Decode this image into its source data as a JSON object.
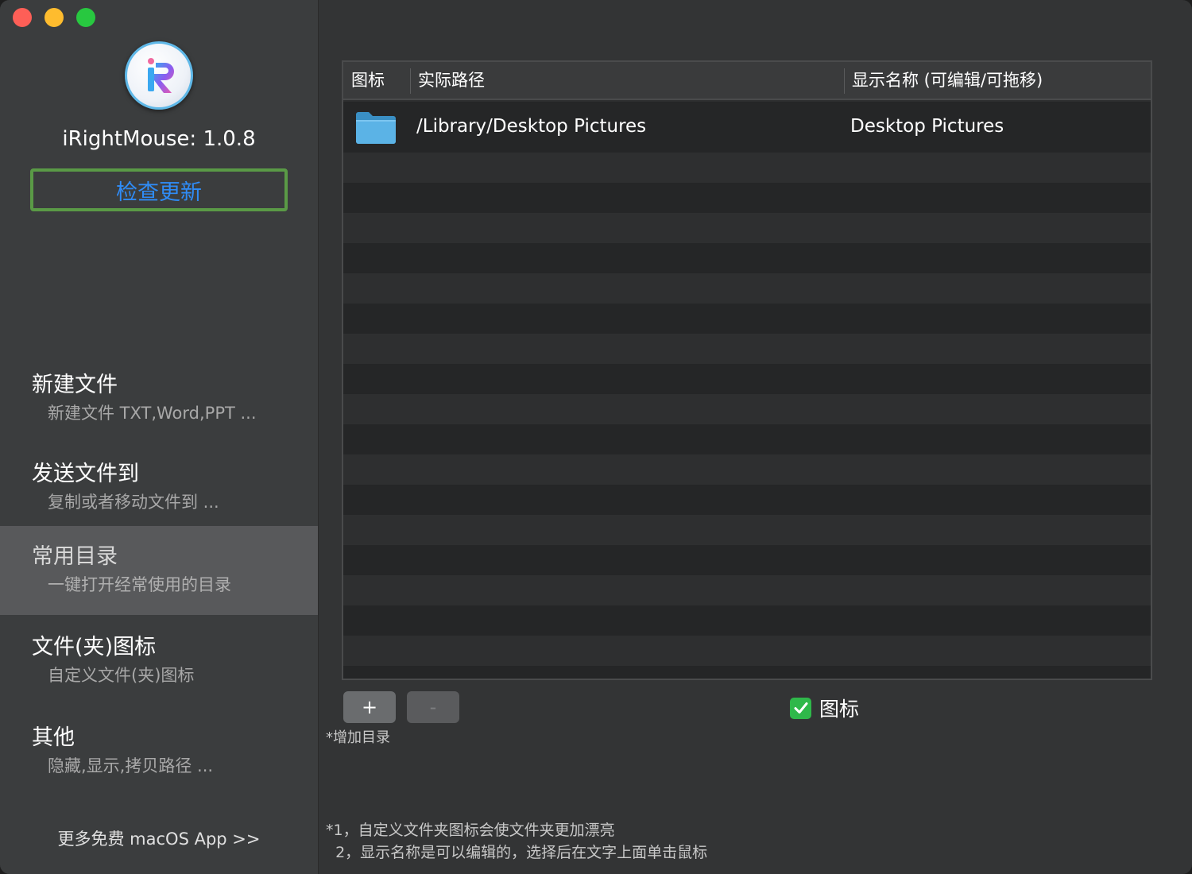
{
  "window": {
    "traffic_lights": {
      "close": "#fe5f57",
      "minimize": "#febc2e",
      "zoom": "#28c840"
    }
  },
  "sidebar": {
    "app_version": "iRightMouse: 1.0.8",
    "update_button": "检查更新",
    "items": [
      {
        "title": "新建文件",
        "subtitle": "新建文件 TXT,Word,PPT ...",
        "active": false
      },
      {
        "title": "发送文件到",
        "subtitle": "复制或者移动文件到 ...",
        "active": false
      },
      {
        "title": "常用目录",
        "subtitle": "一键打开经常使用的目录",
        "active": true
      },
      {
        "title": "文件(夹)图标",
        "subtitle": "自定义文件(夹)图标",
        "active": false
      },
      {
        "title": "其他",
        "subtitle": "隐藏,显示,拷贝路径 ...",
        "active": false
      }
    ],
    "more_link": "更多免费 macOS App >>"
  },
  "table": {
    "columns": [
      "图标",
      "实际路径",
      "显示名称 (可编辑/可拖移)"
    ],
    "rows": [
      {
        "icon": "folder-icon",
        "path": "/Library/Desktop Pictures",
        "display_name": "Desktop Pictures"
      }
    ]
  },
  "controls": {
    "add_label": "+",
    "remove_label": "-",
    "add_hint": "*增加目录",
    "icon_checkbox_label": "图标",
    "icon_checkbox_checked": true
  },
  "notes": [
    "*1，自定义文件夹图标会使文件夹更加漂亮",
    "  2，显示名称是可以编辑的，选择后在文字上面单击鼠标"
  ],
  "colors": {
    "accent_link": "#2f8cf7",
    "update_border": "#5a9a46",
    "checkbox": "#2fb84a"
  }
}
